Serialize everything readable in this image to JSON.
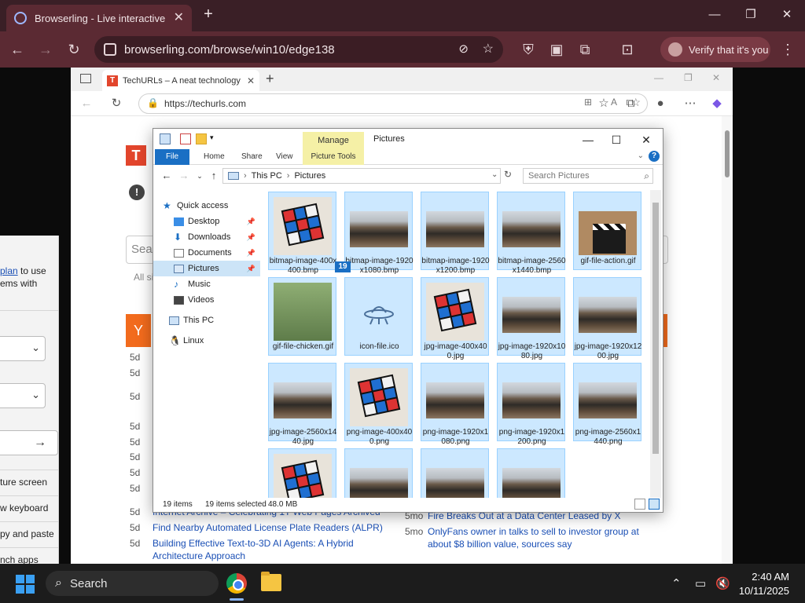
{
  "outer_browser": {
    "tab_title": "Browserling - Live interactive cr",
    "url": "browserling.com/browse/win10/edge138",
    "verify_label": "Verify that it's you"
  },
  "left_panel": {
    "link_text": "plan",
    "line1_suffix": "to use",
    "line2": "ems with",
    "rows": [
      "ture screen",
      "w keyboard",
      "py and paste",
      "nch apps"
    ]
  },
  "inner_browser": {
    "tab_title": "TechURLs – A neat technology ne",
    "tab_fav": "T",
    "url": "https://techurls.com"
  },
  "page": {
    "logo_letter": "T",
    "search_placeholder": "Sear",
    "all_sites": "All si",
    "y_letter": "Y",
    "ages_left": [
      "5d",
      "5d",
      "5d",
      "5d",
      "5d",
      "5d",
      "5d",
      "5d",
      "5d",
      "5d"
    ],
    "news_left": [
      {
        "age": "5d",
        "title": "Internet Archive – Celebrating 1T Web Pages Archived"
      },
      {
        "age": "5d",
        "title": "Find Nearby Automated License Plate Readers (ALPR)"
      },
      {
        "age": "5d",
        "title": "Building Effective Text-to-3D AI Agents: A Hybrid"
      },
      {
        "age": "",
        "title": "Architecture Approach"
      }
    ],
    "news_right": [
      {
        "age": "5mo",
        "title": "Fire Breaks Out at a Data Center Leased by X"
      },
      {
        "age": "5mo",
        "title": "OnlyFans owner in talks to sell to investor group at"
      },
      {
        "age": "",
        "title": "about $8 billion value, sources say"
      }
    ]
  },
  "explorer": {
    "title": "Pictures",
    "manage_tab": "Manage",
    "ribbon_tabs": [
      "File",
      "Home",
      "Share",
      "View",
      "Picture Tools"
    ],
    "breadcrumb": [
      "This PC",
      "Pictures"
    ],
    "search_placeholder": "Search Pictures",
    "nav": [
      {
        "label": "Quick access",
        "icon": "star-icon"
      },
      {
        "label": "Desktop",
        "icon": "desktop-icon",
        "pinned": true
      },
      {
        "label": "Downloads",
        "icon": "download-icon",
        "pinned": true
      },
      {
        "label": "Documents",
        "icon": "document-icon",
        "pinned": true
      },
      {
        "label": "Pictures",
        "icon": "pictures-icon",
        "pinned": true,
        "selected": true
      },
      {
        "label": "Music",
        "icon": "music-icon"
      },
      {
        "label": "Videos",
        "icon": "video-icon"
      },
      {
        "label": "This PC",
        "icon": "computer-icon"
      },
      {
        "label": "Linux",
        "icon": "linux-icon"
      }
    ],
    "files": [
      {
        "name": "bitmap-image-400x400.bmp",
        "thumb": "cube"
      },
      {
        "name": "bitmap-image-1920x1080.bmp",
        "thumb": "landscape"
      },
      {
        "name": "bitmap-image-1920x1200.bmp",
        "thumb": "landscape"
      },
      {
        "name": "bitmap-image-2560x1440.bmp",
        "thumb": "landscape"
      },
      {
        "name": "gif-file-action.gif",
        "thumb": "clapper"
      },
      {
        "name": "gif-file-chicken.gif",
        "thumb": "chicken"
      },
      {
        "name": "icon-file.ico",
        "thumb": "ufo"
      },
      {
        "name": "jpg-image-400x400.jpg",
        "thumb": "cube"
      },
      {
        "name": "jpg-image-1920x1080.jpg",
        "thumb": "landscape"
      },
      {
        "name": "jpg-image-1920x1200.jpg",
        "thumb": "landscape"
      },
      {
        "name": "jpg-image-2560x1440.jpg",
        "thumb": "landscape"
      },
      {
        "name": "png-image-400x400.png",
        "thumb": "cube"
      },
      {
        "name": "png-image-1920x1080.png",
        "thumb": "landscape"
      },
      {
        "name": "png-image-1920x1200.png",
        "thumb": "landscape"
      },
      {
        "name": "png-image-2560x1440.png",
        "thumb": "landscape"
      },
      {
        "name": "",
        "thumb": "cube"
      },
      {
        "name": "",
        "thumb": "landscape"
      },
      {
        "name": "",
        "thumb": "landscape"
      },
      {
        "name": "",
        "thumb": "landscape"
      }
    ],
    "drag_count": "19",
    "status_items": "19 items",
    "status_selected": "19 items selected",
    "status_size": "48.0 MB"
  },
  "taskbar": {
    "search_label": "Search",
    "time": "2:40 AM",
    "date": "10/11/2025"
  },
  "colors": {
    "accent": "#1a6fc4",
    "selection": "#cce8ff",
    "manage_tab": "#f5f0a6",
    "outer_chrome": "#5b2a33"
  }
}
